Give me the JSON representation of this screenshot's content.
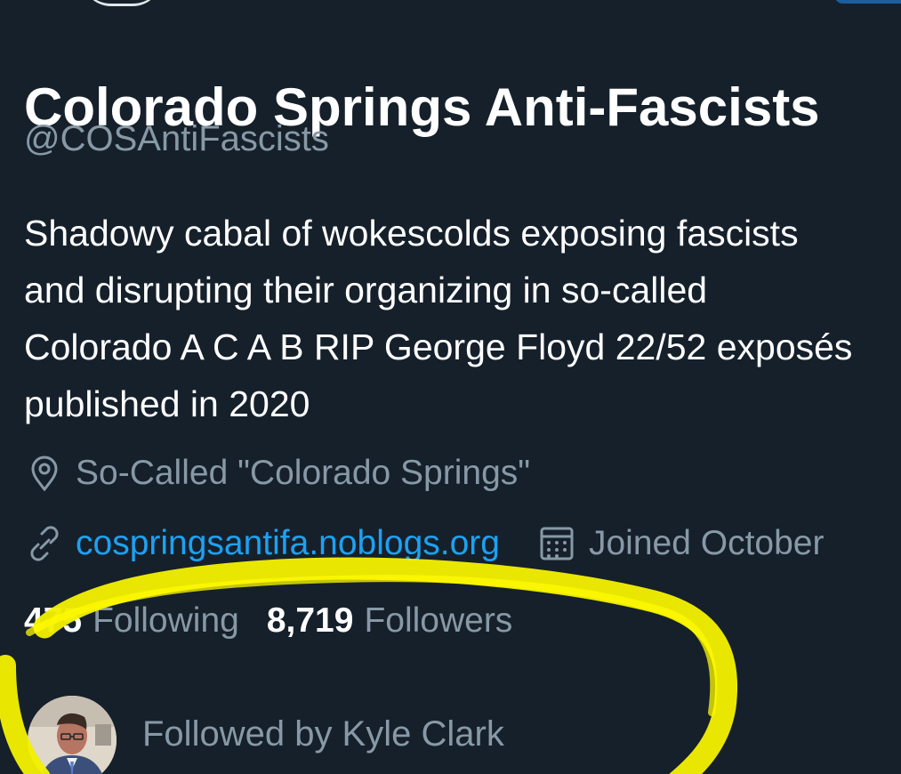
{
  "profile": {
    "display_name": "Colorado Springs Anti-Fascists",
    "handle": "@COSAntiFascists",
    "bio": {
      "line1": "Shadowy cabal of wokescolds exposing fascists",
      "line2": "and disrupting their organizing in so-called",
      "line3": "Colorado A C A B RIP George Floyd 22/52 exposés",
      "line4": "published in 2020"
    },
    "location": "So-Called \"Colorado Springs\"",
    "website": "cospringsantifa.noblogs.org",
    "joined": "Joined October"
  },
  "stats": {
    "following_count": "475",
    "following_label": "Following",
    "followers_count": "8,719",
    "followers_label": "Followers"
  },
  "followed_by": {
    "text": "Followed by Kyle Clark"
  },
  "icons": {
    "location": "location-pin-icon",
    "link": "link-icon",
    "calendar": "calendar-icon"
  },
  "colors": {
    "background": "#15202b",
    "primary_text": "#ffffff",
    "secondary_text": "#8899a6",
    "link": "#1da1f2",
    "highlight": "#f3ef00"
  }
}
